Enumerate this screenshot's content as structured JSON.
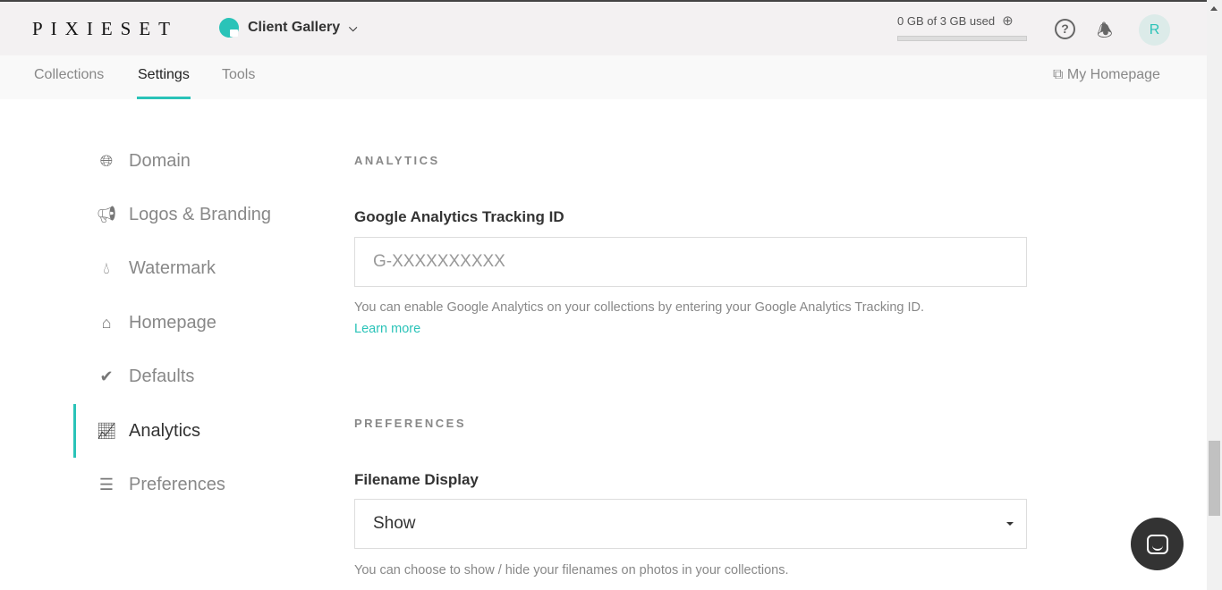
{
  "header": {
    "logo": "PIXIESET",
    "app_switcher": "Client Gallery",
    "storage": "0 GB of 3 GB used",
    "storage_used_fraction": 0,
    "avatar_initial": "R",
    "accent": "#2ac3b8"
  },
  "tabs": [
    {
      "label": "Collections"
    },
    {
      "label": "Settings",
      "active": true
    },
    {
      "label": "Tools"
    }
  ],
  "my_homepage": "My Homepage",
  "sidebar": {
    "items": [
      {
        "label": "Domain",
        "icon": "globe-icon"
      },
      {
        "label": "Logos & Branding",
        "icon": "megaphone-icon"
      },
      {
        "label": "Watermark",
        "icon": "droplet-icon"
      },
      {
        "label": "Homepage",
        "icon": "home-icon"
      },
      {
        "label": "Defaults",
        "icon": "check-circle-icon"
      },
      {
        "label": "Analytics",
        "icon": "chart-line-icon",
        "active": true
      },
      {
        "label": "Preferences",
        "icon": "sliders-icon"
      }
    ]
  },
  "analytics": {
    "heading": "ANALYTICS",
    "field_label": "Google Analytics Tracking ID",
    "placeholder": "G-XXXXXXXXXX",
    "help": "You can enable Google Analytics on your collections by entering your Google Analytics Tracking ID.",
    "learn_more": "Learn more"
  },
  "preferences": {
    "heading": "PREFERENCES",
    "field_label": "Filename Display",
    "value": "Show",
    "help": "You can choose to show / hide your filenames on photos in your collections."
  }
}
